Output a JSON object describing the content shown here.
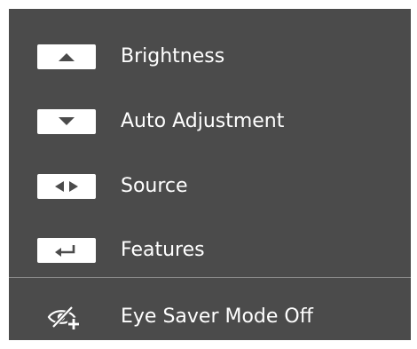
{
  "menu": {
    "items": [
      {
        "key_icon": "up-triangle-icon",
        "label": "Brightness"
      },
      {
        "key_icon": "down-triangle-icon",
        "label": "Auto Adjustment"
      },
      {
        "key_icon": "left-right-triangles-icon",
        "label": "Source"
      },
      {
        "key_icon": "enter-return-icon",
        "label": "Features"
      }
    ],
    "eye_saver": {
      "icon": "eye-saver-off-icon",
      "label": "Eye Saver Mode Off"
    }
  },
  "colors": {
    "panel_background": "#4b4b4b",
    "text": "#ffffff",
    "divider": "#8a8a8a",
    "key_background": "#ffffff",
    "key_glyph": "#4b4b4b"
  }
}
